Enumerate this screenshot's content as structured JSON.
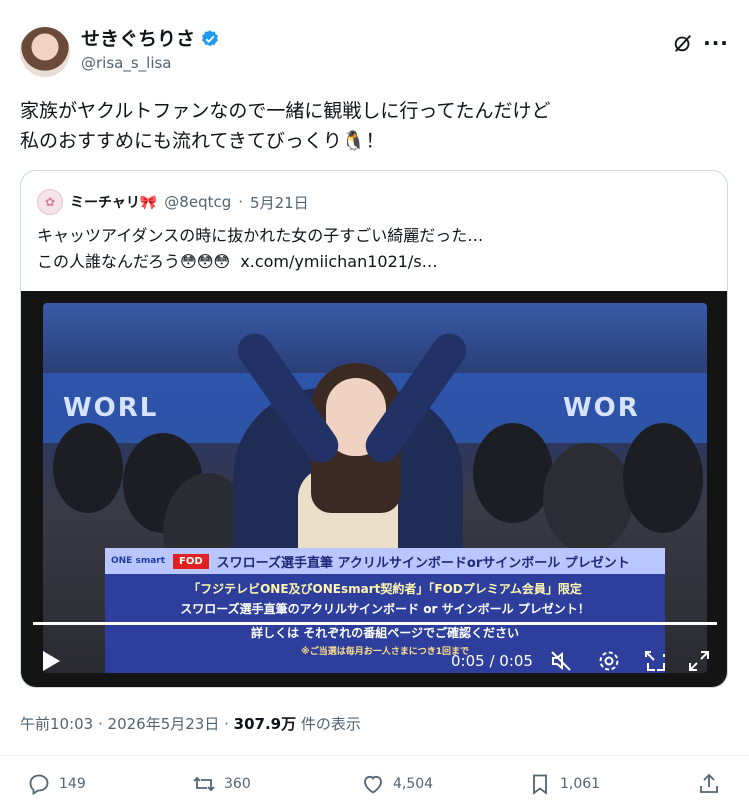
{
  "post": {
    "author_name": "せきぐちりさ",
    "author_handle": "@risa_s_lisa",
    "text": "家族がヤクルトファンなので一緒に観戦しに行ってたんだけど\n私のおすすめにも流れてきてびっくり🐧！"
  },
  "quote": {
    "author_name": "ミーチャリ🎀",
    "author_handle": "@8eqtcg",
    "date": "5月21日",
    "text": "キャッツアイダンスの時に抜かれた女の子すごい綺麗だった…\nこの人誰なんだろう😳😳😳",
    "link": "x.com/ymiichan1021/s…"
  },
  "video": {
    "banner_words": [
      "WORL",
      "WOR"
    ],
    "caption_logo": "ONE smart",
    "caption_badge": "FOD",
    "caption_header": "スワローズ選手直筆 アクリルサインボードorサインボール プレゼント",
    "caption_lines": [
      "「フジテレビONE及びONEsmart契約者」「FODプレミアム会員」限定",
      "スワローズ選手直筆のアクリルサインボード or サインボール プレゼント！",
      "詳しくは それぞれの番組ページでご確認ください",
      "※ご当選は毎月お一人さまにつき1回まで"
    ],
    "time": "0:05 / 0:05",
    "progress": 1.0
  },
  "meta": {
    "time": "午前10:03",
    "date": "2026年5月23日",
    "views": "307.9万",
    "views_label": "件の表示"
  },
  "actions": {
    "replies": "149",
    "retweets": "360",
    "likes": "4,504",
    "bookmarks": "1,061"
  },
  "colors": {
    "verified": "#1d9bf0",
    "text_primary": "#0f1419",
    "text_secondary": "#536471",
    "border": "#cfd9de"
  }
}
